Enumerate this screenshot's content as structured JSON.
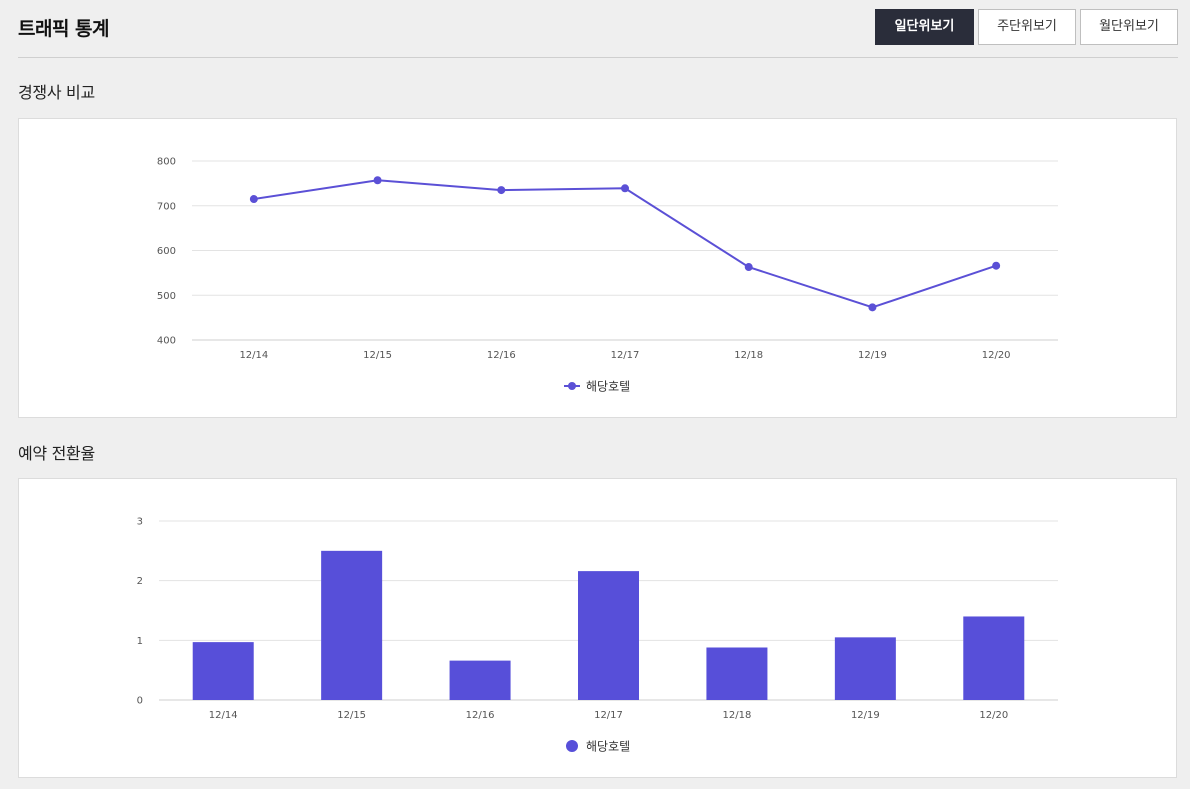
{
  "header": {
    "title": "트래픽 통계",
    "buttons": [
      {
        "label": "일단위보기",
        "active": true
      },
      {
        "label": "주단위보기",
        "active": false
      },
      {
        "label": "월단위보기",
        "active": false
      }
    ]
  },
  "sections": [
    {
      "title": "경쟁사 비교"
    },
    {
      "title": "예약 전환율"
    }
  ],
  "colors": {
    "accent": "#5b50d6",
    "bar": "#574fd9",
    "grid": "#e3e3e3",
    "active_button": "#2a2d3a"
  },
  "chart_data": [
    {
      "type": "line",
      "title": "",
      "categories": [
        "12/14",
        "12/15",
        "12/16",
        "12/17",
        "12/18",
        "12/19",
        "12/20"
      ],
      "series": [
        {
          "name": "해당호텔",
          "values": [
            715,
            757,
            735,
            739,
            563,
            473,
            566
          ]
        }
      ],
      "yticks": [
        "400",
        "500",
        "600",
        "700",
        "800"
      ],
      "ylim": [
        400,
        800
      ],
      "grid": true,
      "legend": "bottom-center"
    },
    {
      "type": "bar",
      "title": "",
      "categories": [
        "12/14",
        "12/15",
        "12/16",
        "12/17",
        "12/18",
        "12/19",
        "12/20"
      ],
      "series": [
        {
          "name": "해당호텔",
          "values": [
            0.97,
            2.5,
            0.66,
            2.16,
            0.88,
            1.05,
            1.4
          ]
        }
      ],
      "yticks": [
        "0",
        "1",
        "2",
        "3"
      ],
      "ylim": [
        0,
        3
      ],
      "grid": true,
      "legend": "bottom-center"
    }
  ]
}
